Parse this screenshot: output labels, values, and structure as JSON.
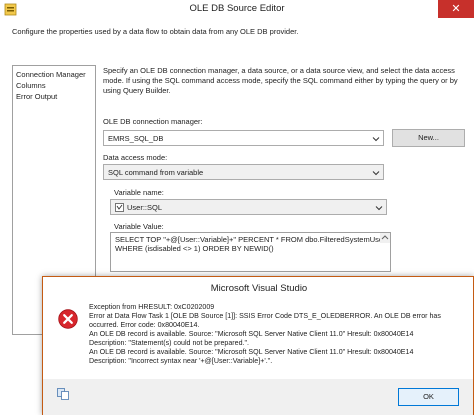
{
  "window": {
    "title": "OLE DB Source Editor",
    "close_glyph": "✕",
    "description": "Configure the properties used by a data flow to obtain data from any OLE DB provider."
  },
  "nav": {
    "items": [
      "Connection Manager",
      "Columns",
      "Error Output"
    ]
  },
  "connection_page": {
    "instructions": "Specify an OLE DB connection manager, a data source, or a data source view, and select the data access mode. If using the SQL command access mode, specify the SQL command either by typing the query or by using Query Builder.",
    "connection_manager_label": "OLE DB connection manager:",
    "connection_manager_value": "EMRS_SQL_DB",
    "new_button": "New...",
    "data_access_label": "Data access mode:",
    "data_access_value": "SQL command from variable",
    "variable_name_label": "Variable name:",
    "variable_name_value": "User::SQL",
    "variable_value_label": "Variable Value:",
    "variable_value_line1": "SELECT  TOP \"+@[User::Variable]+\" PERCENT * FROM  dbo.FilteredSystemUser",
    "variable_value_line2": "WHERE (isdisabled <> 1) ORDER BY NEWID()"
  },
  "dialog": {
    "title": "Microsoft Visual Studio",
    "lines": [
      "Exception from HRESULT: 0xC0202009",
      "Error at Data Flow Task 1 [OLE DB Source [1]]: SSIS Error Code DTS_E_OLEDBERROR.  An OLE DB error has",
      "occurred. Error code: 0x80040E14.",
      "An OLE DB record is available.  Source: \"Microsoft SQL Server Native Client 11.0\"  Hresult: 0x80040E14",
      "Description: \"Statement(s) could not be prepared.\".",
      "An OLE DB record is available.  Source: \"Microsoft SQL Server Native Client 11.0\"  Hresult: 0x80040E14",
      "Description: \"Incorrect syntax near '+@[User::Variable]+'.\"."
    ],
    "ok_button": "OK"
  },
  "colors": {
    "close_red": "#c7302b",
    "error_red": "#d7262c",
    "dialog_border": "#c45b13",
    "ok_border": "#0078d7"
  },
  "icons": [
    "app-icon",
    "close-icon",
    "chevron-down-icon",
    "variable-icon",
    "error-icon",
    "copy-icon",
    "scroll-up-icon"
  ]
}
